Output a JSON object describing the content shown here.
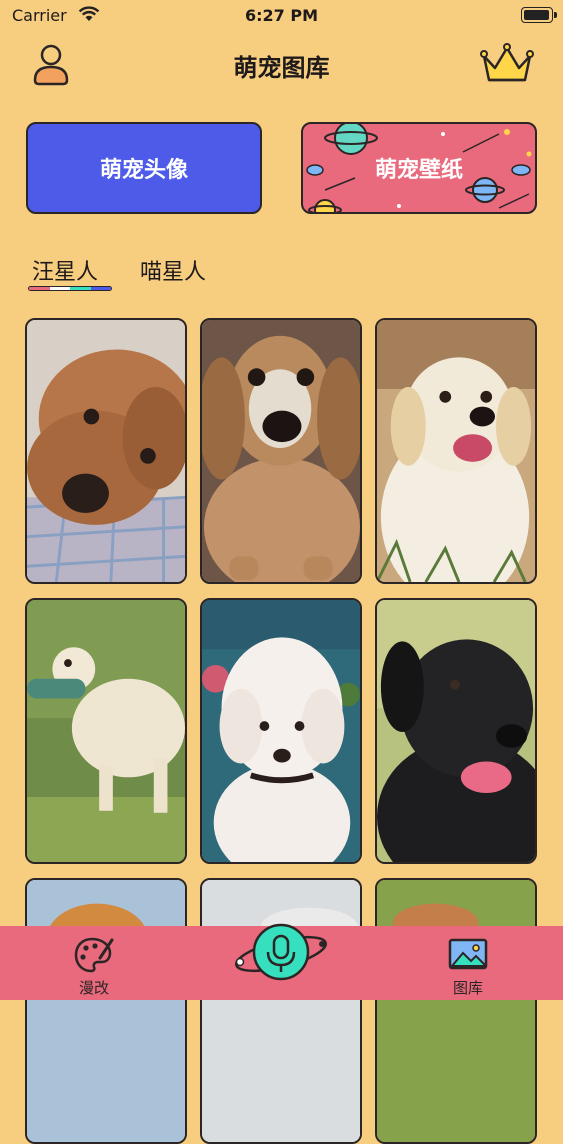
{
  "status_bar": {
    "carrier": "Carrier",
    "time": "6:27 PM"
  },
  "nav": {
    "title": "萌宠图库"
  },
  "features": {
    "avatar_label": "萌宠头像",
    "wallpaper_label": "萌宠壁纸"
  },
  "tabs": {
    "dog": "汪星人",
    "cat": "喵星人",
    "selected": "汪星人"
  },
  "tab_bar": {
    "edit_label": "漫改",
    "gallery_label": "图库"
  },
  "colors": {
    "background": "#f7cd80",
    "avatar_button": "#4d5be8",
    "wallpaper_button": "#ea6a7d",
    "tab_bar": "#e86a7c",
    "mic_button": "#36dfbe"
  },
  "photos": [
    {
      "subject": "brown poodle lying down"
    },
    {
      "subject": "dachshund"
    },
    {
      "subject": "golden retriever"
    },
    {
      "subject": "golden retriever with toy"
    },
    {
      "subject": "white poodle"
    },
    {
      "subject": "black labrador"
    },
    {
      "subject": "golden retriever"
    },
    {
      "subject": "light dog"
    },
    {
      "subject": "brown dog"
    }
  ]
}
